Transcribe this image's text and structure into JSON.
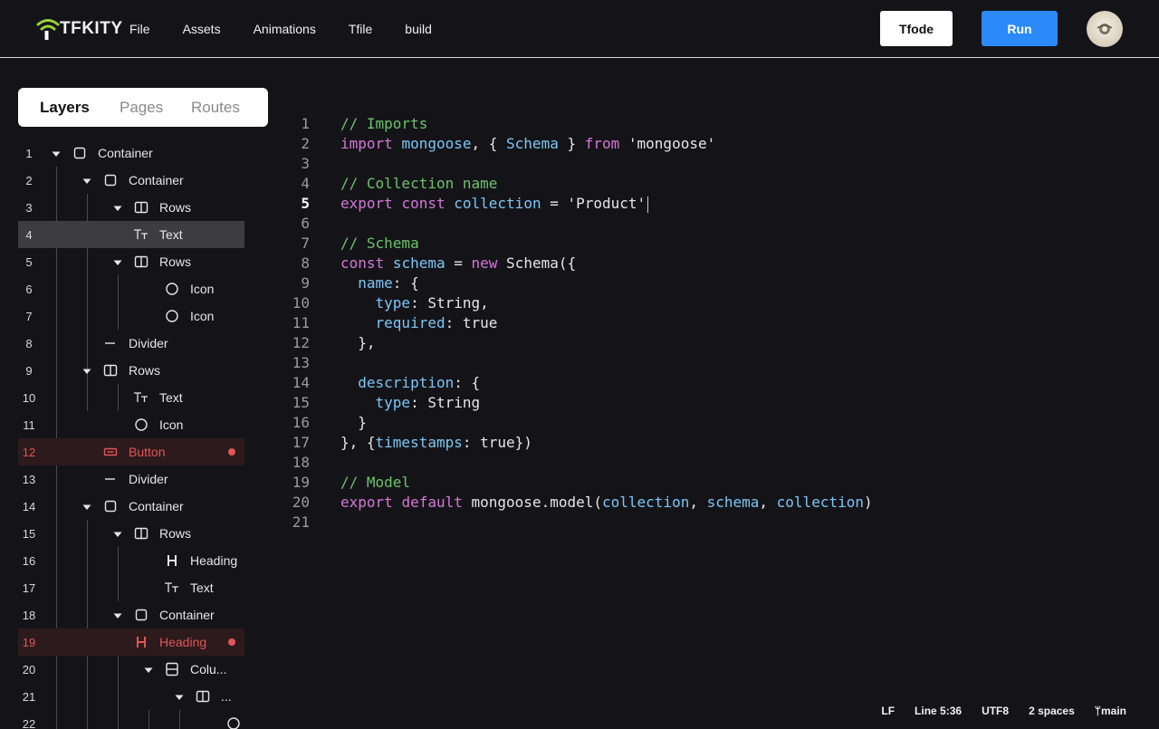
{
  "header": {
    "logo_text": "TFKITY",
    "menu": [
      "File",
      "Assets",
      "Animations",
      "Tfile",
      "build"
    ],
    "tfode_label": "Tfode",
    "run_label": "Run",
    "colors": {
      "accent": "#2b8af7",
      "logo_mark": "#9ad23a"
    }
  },
  "tabs": [
    {
      "label": "Layers",
      "active": true
    },
    {
      "label": "Pages",
      "active": false
    },
    {
      "label": "Routes",
      "active": false
    }
  ],
  "layers": [
    {
      "num": "1",
      "depth": 0,
      "caret": true,
      "icon": "square-icon",
      "label": "Container"
    },
    {
      "num": "2",
      "depth": 1,
      "caret": true,
      "icon": "square-icon",
      "label": "Container"
    },
    {
      "num": "3",
      "depth": 2,
      "caret": true,
      "icon": "rows-icon",
      "label": "Rows"
    },
    {
      "num": "4",
      "depth": 2,
      "caret": false,
      "icon": "text-icon",
      "label": "Text",
      "state": "selected"
    },
    {
      "num": "5",
      "depth": 2,
      "caret": true,
      "icon": "rows-icon",
      "label": "Rows"
    },
    {
      "num": "6",
      "depth": 3,
      "caret": false,
      "icon": "circle-icon",
      "label": "Icon"
    },
    {
      "num": "7",
      "depth": 3,
      "caret": false,
      "icon": "circle-icon",
      "label": "Icon"
    },
    {
      "num": "8",
      "depth": 1,
      "caret": false,
      "icon": "divider-icon",
      "label": "Divider"
    },
    {
      "num": "9",
      "depth": 1,
      "caret": true,
      "icon": "rows-icon",
      "label": "Rows"
    },
    {
      "num": "10",
      "depth": 2,
      "caret": false,
      "icon": "text-icon",
      "label": "Text"
    },
    {
      "num": "11",
      "depth": 2,
      "caret": false,
      "icon": "circle-icon",
      "label": "Icon"
    },
    {
      "num": "12",
      "depth": 1,
      "caret": false,
      "icon": "button-icon",
      "label": "Button",
      "state": "error"
    },
    {
      "num": "13",
      "depth": 1,
      "caret": false,
      "icon": "divider-icon",
      "label": "Divider"
    },
    {
      "num": "14",
      "depth": 1,
      "caret": true,
      "icon": "square-icon",
      "label": "Container"
    },
    {
      "num": "15",
      "depth": 2,
      "caret": true,
      "icon": "rows-icon",
      "label": "Rows"
    },
    {
      "num": "16",
      "depth": 3,
      "caret": false,
      "icon": "heading-icon",
      "label": "Heading"
    },
    {
      "num": "17",
      "depth": 3,
      "caret": false,
      "icon": "text-icon",
      "label": "Text"
    },
    {
      "num": "18",
      "depth": 2,
      "caret": true,
      "icon": "square-icon",
      "label": "Container"
    },
    {
      "num": "19",
      "depth": 2,
      "caret": false,
      "icon": "heading-icon",
      "label": "Heading",
      "state": "error"
    },
    {
      "num": "20",
      "depth": 3,
      "caret": true,
      "icon": "columns-icon",
      "label": "Colu..."
    },
    {
      "num": "21",
      "depth": 4,
      "caret": true,
      "icon": "rows-icon",
      "label": "..."
    },
    {
      "num": "22",
      "depth": 5,
      "caret": false,
      "icon": "circle-icon",
      "label": "..."
    }
  ],
  "code": {
    "current_line": 5,
    "lines": [
      [
        [
          "com",
          "// Imports"
        ]
      ],
      [
        [
          "kw",
          "import"
        ],
        [
          "txt",
          " "
        ],
        [
          "id",
          "mongoose"
        ],
        [
          "txt",
          ", { "
        ],
        [
          "id",
          "Schema"
        ],
        [
          "txt",
          " } "
        ],
        [
          "kw",
          "from"
        ],
        [
          "txt",
          " 'mongoose'"
        ]
      ],
      [],
      [
        [
          "com",
          "// Collection name"
        ]
      ],
      [
        [
          "kw",
          "export"
        ],
        [
          "txt",
          " "
        ],
        [
          "kw",
          "const"
        ],
        [
          "txt",
          " "
        ],
        [
          "id",
          "collection"
        ],
        [
          "txt",
          " = 'Product'"
        ],
        [
          "cursor",
          ""
        ]
      ],
      [],
      [
        [
          "com",
          "// Schema"
        ]
      ],
      [
        [
          "kw",
          "const"
        ],
        [
          "txt",
          " "
        ],
        [
          "id",
          "schema"
        ],
        [
          "txt",
          " = "
        ],
        [
          "kw",
          "new"
        ],
        [
          "txt",
          " Schema({"
        ]
      ],
      [
        [
          "txt",
          "  "
        ],
        [
          "id",
          "name"
        ],
        [
          "txt",
          ": {"
        ]
      ],
      [
        [
          "txt",
          "    "
        ],
        [
          "id",
          "type"
        ],
        [
          "txt",
          ": String,"
        ]
      ],
      [
        [
          "txt",
          "    "
        ],
        [
          "id",
          "required"
        ],
        [
          "txt",
          ": true"
        ]
      ],
      [
        [
          "txt",
          "  },"
        ]
      ],
      [],
      [
        [
          "txt",
          "  "
        ],
        [
          "id",
          "description"
        ],
        [
          "txt",
          ": {"
        ]
      ],
      [
        [
          "txt",
          "    "
        ],
        [
          "id",
          "type"
        ],
        [
          "txt",
          ": String"
        ]
      ],
      [
        [
          "txt",
          "  }"
        ]
      ],
      [
        [
          "txt",
          "}, {"
        ],
        [
          "id",
          "timestamps"
        ],
        [
          "txt",
          ": true})"
        ]
      ],
      [],
      [
        [
          "com",
          "// Model"
        ]
      ],
      [
        [
          "kw",
          "export"
        ],
        [
          "txt",
          " "
        ],
        [
          "kw",
          "default"
        ],
        [
          "txt",
          " mongoose.model("
        ],
        [
          "id",
          "collection"
        ],
        [
          "txt",
          ", "
        ],
        [
          "id",
          "schema"
        ],
        [
          "txt",
          ", "
        ],
        [
          "id",
          "collection"
        ],
        [
          "txt",
          ")"
        ]
      ],
      []
    ]
  },
  "status": {
    "eol": "LF",
    "position": "Line 5:36",
    "encoding": "UTF8",
    "indent": "2 spaces",
    "branch": "main"
  }
}
